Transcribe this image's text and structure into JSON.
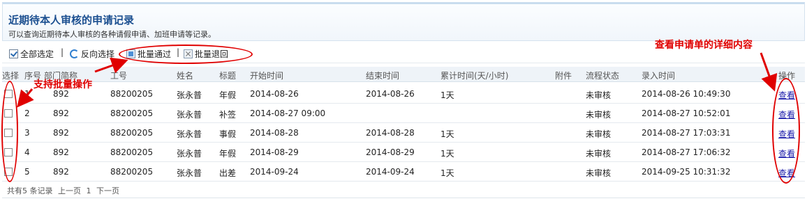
{
  "header": {
    "title": "近期待本人审核的申请记录",
    "subtitle": "可以查询近期待本人审核的各种请假申请、加班申请等记录。"
  },
  "toolbar": {
    "select_all": "全部选定",
    "invert_selection": "反向选择",
    "batch_approve": "批量通过",
    "batch_reject": "批量退回",
    "separator": "|"
  },
  "table": {
    "columns": {
      "select": "选择",
      "index": "序号",
      "dept": "部门简称",
      "emp_no": "工号",
      "name": "姓名",
      "title": "标题",
      "start": "开始时间",
      "end": "结束时间",
      "duration": "累计时间(天/小时)",
      "attachment": "附件",
      "status": "流程状态",
      "entered": "录入时间",
      "action": "操作"
    },
    "rows": [
      {
        "index": "1",
        "dept": "892",
        "emp_no": "88200205",
        "name": "张永普",
        "title": "年假",
        "start": "2014-08-26",
        "end": "2014-08-26",
        "duration": "1天",
        "attachment": "",
        "status": "未审核",
        "entered": "2014-08-26 10:49:30",
        "action": "查看"
      },
      {
        "index": "2",
        "dept": "892",
        "emp_no": "88200205",
        "name": "张永普",
        "title": "补签",
        "start": "2014-08-27 09:00",
        "end": "",
        "duration": "",
        "attachment": "",
        "status": "未审核",
        "entered": "2014-08-27 10:52:01",
        "action": "查看"
      },
      {
        "index": "3",
        "dept": "892",
        "emp_no": "88200205",
        "name": "张永普",
        "title": "事假",
        "start": "2014-08-28",
        "end": "2014-08-28",
        "duration": "1天",
        "attachment": "",
        "status": "未审核",
        "entered": "2014-08-27 17:03:31",
        "action": "查看"
      },
      {
        "index": "4",
        "dept": "892",
        "emp_no": "88200205",
        "name": "张永普",
        "title": "年假",
        "start": "2014-08-29",
        "end": "2014-08-29",
        "duration": "1天",
        "attachment": "",
        "status": "未审核",
        "entered": "2014-08-27 17:06:32",
        "action": "查看"
      },
      {
        "index": "5",
        "dept": "892",
        "emp_no": "88200205",
        "name": "张永普",
        "title": "出差",
        "start": "2014-09-24",
        "end": "2014-09-24",
        "duration": "1天",
        "attachment": "",
        "status": "未审核",
        "entered": "2014-09-25 10:31:32",
        "action": "查看"
      }
    ]
  },
  "pager": {
    "summary": "共有5 条记录",
    "prev": "上一页",
    "current_page": "1",
    "next": "下一页"
  },
  "annotations": {
    "batch_note": "支持批量操作",
    "detail_note": "查看申请单的详细内容",
    "color": "#e00000"
  }
}
